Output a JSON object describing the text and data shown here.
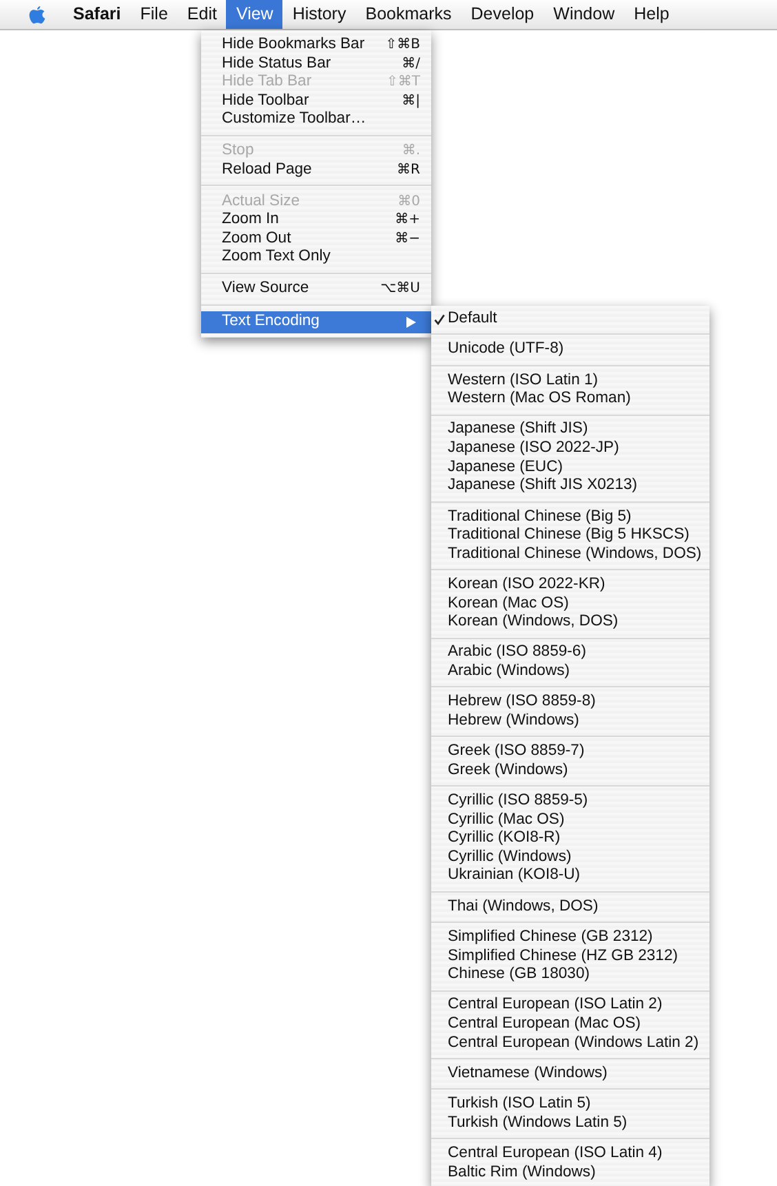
{
  "menubar": {
    "app": "Safari",
    "items": [
      {
        "label": "File",
        "selected": false
      },
      {
        "label": "Edit",
        "selected": false
      },
      {
        "label": "View",
        "selected": true
      },
      {
        "label": "History",
        "selected": false
      },
      {
        "label": "Bookmarks",
        "selected": false
      },
      {
        "label": "Develop",
        "selected": false
      },
      {
        "label": "Window",
        "selected": false
      },
      {
        "label": "Help",
        "selected": false
      }
    ]
  },
  "view_menu": {
    "items": [
      {
        "kind": "item",
        "label": "Hide Bookmarks Bar",
        "shortcut": "⇧⌘B",
        "disabled": false,
        "highlighted": false
      },
      {
        "kind": "item",
        "label": "Hide Status Bar",
        "shortcut": "⌘/",
        "disabled": false,
        "highlighted": false
      },
      {
        "kind": "item",
        "label": "Hide Tab Bar",
        "shortcut": "⇧⌘T",
        "disabled": true,
        "highlighted": false
      },
      {
        "kind": "item",
        "label": "Hide Toolbar",
        "shortcut": "⌘|",
        "disabled": false,
        "highlighted": false
      },
      {
        "kind": "item",
        "label": "Customize Toolbar…",
        "disabled": false,
        "highlighted": false
      },
      {
        "kind": "separator"
      },
      {
        "kind": "item",
        "label": "Stop",
        "shortcut": "⌘.",
        "disabled": true,
        "highlighted": false
      },
      {
        "kind": "item",
        "label": "Reload Page",
        "shortcut": "⌘R",
        "disabled": false,
        "highlighted": false
      },
      {
        "kind": "separator"
      },
      {
        "kind": "item",
        "label": "Actual Size",
        "shortcut": "⌘0",
        "disabled": true,
        "highlighted": false
      },
      {
        "kind": "item",
        "label": "Zoom In",
        "shortcut": "⌘+",
        "disabled": false,
        "highlighted": false
      },
      {
        "kind": "item",
        "label": "Zoom Out",
        "shortcut": "⌘−",
        "disabled": false,
        "highlighted": false
      },
      {
        "kind": "item",
        "label": "Zoom Text Only",
        "disabled": false,
        "highlighted": false
      },
      {
        "kind": "separator"
      },
      {
        "kind": "item",
        "label": "View Source",
        "shortcut": "⌥⌘U",
        "disabled": false,
        "highlighted": false
      },
      {
        "kind": "separator"
      },
      {
        "kind": "submenu",
        "label": "Text Encoding",
        "disabled": false,
        "highlighted": true
      }
    ]
  },
  "text_encoding_menu": {
    "groups": [
      [
        {
          "label": "Default",
          "checked": true
        }
      ],
      [
        {
          "label": "Unicode (UTF-8)",
          "checked": false
        }
      ],
      [
        {
          "label": "Western (ISO Latin 1)",
          "checked": false
        },
        {
          "label": "Western (Mac OS Roman)",
          "checked": false
        }
      ],
      [
        {
          "label": "Japanese (Shift JIS)",
          "checked": false
        },
        {
          "label": "Japanese (ISO 2022-JP)",
          "checked": false
        },
        {
          "label": "Japanese (EUC)",
          "checked": false
        },
        {
          "label": "Japanese (Shift JIS X0213)",
          "checked": false
        }
      ],
      [
        {
          "label": "Traditional Chinese (Big 5)",
          "checked": false
        },
        {
          "label": "Traditional Chinese (Big 5 HKSCS)",
          "checked": false
        },
        {
          "label": "Traditional Chinese (Windows, DOS)",
          "checked": false
        }
      ],
      [
        {
          "label": "Korean (ISO 2022-KR)",
          "checked": false
        },
        {
          "label": "Korean (Mac OS)",
          "checked": false
        },
        {
          "label": "Korean (Windows, DOS)",
          "checked": false
        }
      ],
      [
        {
          "label": "Arabic (ISO 8859-6)",
          "checked": false
        },
        {
          "label": "Arabic (Windows)",
          "checked": false
        }
      ],
      [
        {
          "label": "Hebrew (ISO 8859-8)",
          "checked": false
        },
        {
          "label": "Hebrew (Windows)",
          "checked": false
        }
      ],
      [
        {
          "label": "Greek (ISO 8859-7)",
          "checked": false
        },
        {
          "label": "Greek (Windows)",
          "checked": false
        }
      ],
      [
        {
          "label": "Cyrillic (ISO 8859-5)",
          "checked": false
        },
        {
          "label": "Cyrillic (Mac OS)",
          "checked": false
        },
        {
          "label": "Cyrillic (KOI8-R)",
          "checked": false
        },
        {
          "label": "Cyrillic (Windows)",
          "checked": false
        },
        {
          "label": "Ukrainian (KOI8-U)",
          "checked": false
        }
      ],
      [
        {
          "label": "Thai (Windows, DOS)",
          "checked": false
        }
      ],
      [
        {
          "label": "Simplified Chinese (GB 2312)",
          "checked": false
        },
        {
          "label": "Simplified Chinese (HZ GB 2312)",
          "checked": false
        },
        {
          "label": "Chinese (GB 18030)",
          "checked": false
        }
      ],
      [
        {
          "label": "Central European (ISO Latin 2)",
          "checked": false
        },
        {
          "label": "Central European (Mac OS)",
          "checked": false
        },
        {
          "label": "Central European (Windows Latin 2)",
          "checked": false
        }
      ],
      [
        {
          "label": "Vietnamese (Windows)",
          "checked": false
        }
      ],
      [
        {
          "label": "Turkish (ISO Latin 5)",
          "checked": false
        },
        {
          "label": "Turkish (Windows Latin 5)",
          "checked": false
        }
      ],
      [
        {
          "label": "Central European (ISO Latin 4)",
          "checked": false
        },
        {
          "label": "Baltic Rim (Windows)",
          "checked": false
        }
      ]
    ]
  }
}
